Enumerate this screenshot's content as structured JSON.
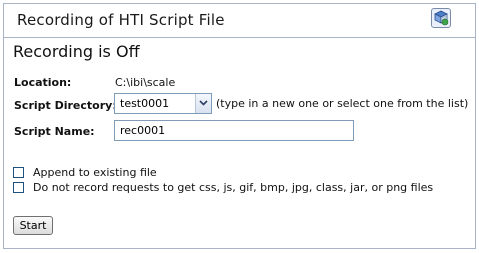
{
  "title": "Recording of HTI Script File",
  "status": "Recording is Off",
  "location": {
    "label": "Location:",
    "value": "C:\\ibi\\scale"
  },
  "script_directory": {
    "label": "Script Directory:",
    "selected": "test0001",
    "hint": "(type in a new one or select one from the list)"
  },
  "script_name": {
    "label": "Script Name:",
    "value": "rec0001"
  },
  "options": [
    {
      "label": "Append to existing file",
      "checked": false
    },
    {
      "label": "Do not record requests to get css, js, gif, bmp, jpg, class, jar, or png files",
      "checked": false
    }
  ],
  "start_label": "Start",
  "icons": {
    "help": "help-book-icon",
    "dropdown": "chevron-down-icon"
  }
}
